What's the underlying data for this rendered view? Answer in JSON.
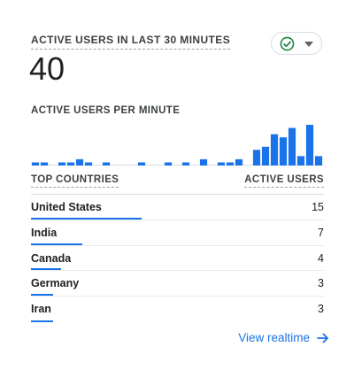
{
  "card": {
    "title": "ACTIVE USERS IN LAST 30 MINUTES",
    "value": "40",
    "subtitle": "ACTIVE USERS PER MINUTE",
    "status_icon": "check-circle-icon",
    "dropdown_icon": "caret-down-icon",
    "colors": {
      "accent": "#1a73e8",
      "status_green": "#188038"
    }
  },
  "chart_data": {
    "type": "bar",
    "title": "ACTIVE USERS PER MINUTE",
    "values": [
      1,
      1,
      0,
      1,
      1,
      2,
      1,
      0,
      1,
      0,
      0,
      0,
      1,
      0,
      0,
      1,
      0,
      1,
      0,
      2,
      0,
      1,
      1,
      2,
      0,
      5,
      6,
      10,
      9,
      12,
      3,
      13,
      3
    ],
    "ylim": [
      0,
      13
    ],
    "grid": false
  },
  "table": {
    "col_country": "TOP COUNTRIES",
    "col_users": "ACTIVE USERS",
    "rows": [
      {
        "country": "United States",
        "users": "15",
        "share": 0.15
      },
      {
        "country": "India",
        "users": "7",
        "share": 0.07
      },
      {
        "country": "Canada",
        "users": "4",
        "share": 0.04
      },
      {
        "country": "Germany",
        "users": "3",
        "share": 0.03
      },
      {
        "country": "Iran",
        "users": "3",
        "share": 0.03
      }
    ]
  },
  "footer": {
    "link_label": "View realtime",
    "link_icon": "arrow-right-icon"
  }
}
